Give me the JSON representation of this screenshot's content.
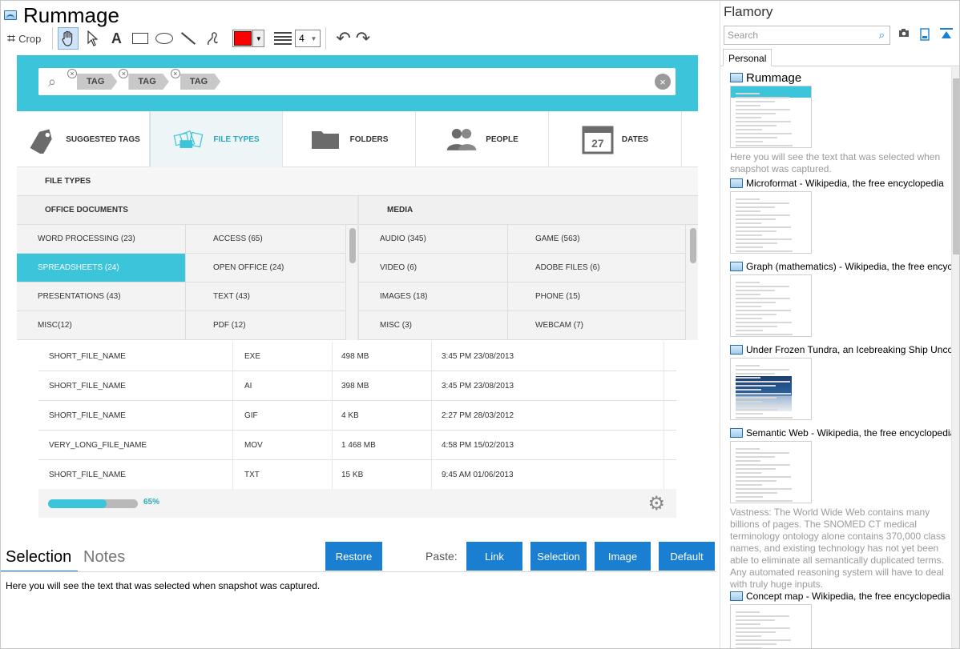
{
  "app": {
    "title": "Rummage"
  },
  "toolbar": {
    "crop_label": "Crop",
    "text_tool": "A",
    "line_width": "4"
  },
  "canvas": {
    "tags": [
      "TAG",
      "TAG",
      "TAG"
    ],
    "tabs": [
      {
        "label": "SUGGESTED TAGS",
        "icon": "tag-icon"
      },
      {
        "label": "FILE TYPES",
        "icon": "file-types-icon",
        "active": true
      },
      {
        "label": "FOLDERS",
        "icon": "folder-icon"
      },
      {
        "label": "PEOPLE",
        "icon": "people-icon"
      },
      {
        "label": "DATES",
        "icon": "calendar-icon",
        "date": "27"
      }
    ],
    "panel_title": "FILE TYPES",
    "office_heading": "OFFICE DOCUMENTS",
    "media_heading": "MEDIA",
    "office_items": [
      "WORD PROCESSING (23)",
      "ACCESS (65)",
      "SPREADSHEETS (24)",
      "OPEN OFFICE (24)",
      "PRESENTATIONS (43)",
      "TEXT (43)",
      "MISC(12)",
      "PDF (12)"
    ],
    "media_items": [
      "AUDIO (345)",
      "GAME (563)",
      "VIDEO (6)",
      "ADOBE FILES (6)",
      "IMAGES (18)",
      "PHONE (15)",
      "MISC (3)",
      "WEBCAM (7)"
    ],
    "files": [
      {
        "name": "SHORT_FILE_NAME",
        "type": "EXE",
        "size": "498 MB",
        "date": "3:45 PM 23/08/2013"
      },
      {
        "name": "SHORT_FILE_NAME",
        "type": " AI",
        "size": "398 MB",
        "date": "3:45 PM 23/08/2013"
      },
      {
        "name": "SHORT_FILE_NAME",
        "type": "GIF",
        "size": "4 KB",
        "date": "2:27 PM 28/03/2012"
      },
      {
        "name": "VERY_LONG_FILE_NAME",
        "type": "MOV",
        "size": "1 468 MB",
        "date": "4:58 PM 15/02/2013"
      },
      {
        "name": "SHORT_FILE_NAME",
        "type": "TXT",
        "size": "15 KB",
        "date": "9:45 AM 01/06/2013"
      }
    ],
    "progress": {
      "percent": 65,
      "label": "65%"
    },
    "colors": {
      "accent": "#3bc4da"
    }
  },
  "bottom": {
    "tab_selection": "Selection",
    "tab_notes": "Notes",
    "restore_label": "Restore",
    "paste_label": "Paste:",
    "link_label": "Link",
    "selection_label": "Selection",
    "image_label": "Image",
    "default_label": "Default",
    "selection_text": "Here you will see the text that was selected when snapshot was captured."
  },
  "side": {
    "title": "Flamory",
    "search_placeholder": "Search",
    "tab_personal": "Personal",
    "entries": [
      {
        "title": "Rummage",
        "desc": "Here you will see the text that was selected when snapshot was captured."
      },
      {
        "title": "Microformat - Wikipedia, the free encyclopedia",
        "desc": ""
      },
      {
        "title": "Graph (mathematics) - Wikipedia, the free encyclopedia",
        "desc": ""
      },
      {
        "title": "Under Frozen Tundra, an Icebreaking Ship Uncovers",
        "desc": ""
      },
      {
        "title": "Semantic Web - Wikipedia, the free encyclopedia",
        "desc": "Vastness: The World Wide Web contains many billions of pages. The SNOMED CT medical terminology ontology alone contains 370,000 class names, and existing technology has not yet been able to eliminate all semantically duplicated terms. Any automated reasoning system will have to deal with truly huge inputs."
      },
      {
        "title": "Concept map - Wikipedia, the free encyclopedia",
        "desc": ""
      }
    ],
    "colors": {
      "link": "#1b7fd1"
    }
  }
}
